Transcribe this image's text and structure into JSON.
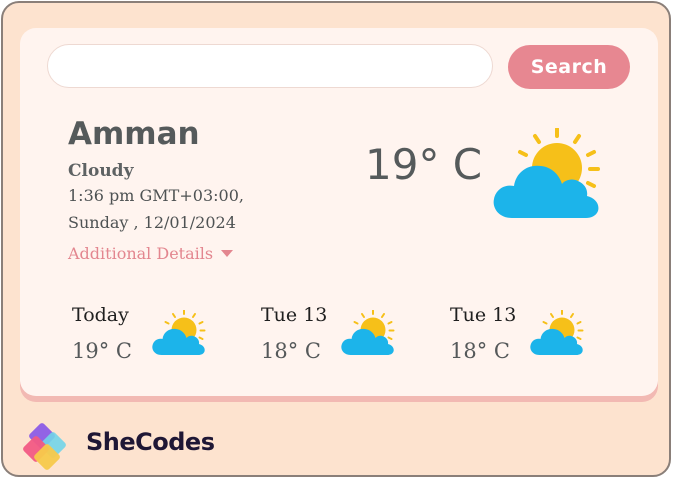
{
  "search": {
    "placeholder": "",
    "value": "",
    "button_label": "Search"
  },
  "current": {
    "city": "Amman",
    "description": "Cloudy",
    "time": "1:36 pm GMT+03:00,",
    "date": "Sunday , 12/01/2024",
    "details_link": "Additional Details",
    "temperature": "19° C",
    "icon": "partly-cloudy-icon"
  },
  "forecast": [
    {
      "label": "Today",
      "temp": "19° C",
      "icon": "partly-cloudy-icon"
    },
    {
      "label": "Tue 13",
      "temp": "18° C",
      "icon": "partly-cloudy-icon"
    },
    {
      "label": "Tue 13",
      "temp": "18° C",
      "icon": "partly-cloudy-icon"
    }
  ],
  "brand": {
    "name": "SheCodes",
    "logo": "shecodes-logo-icon"
  },
  "colors": {
    "page_bg": "#fde3cf",
    "card_bg": "#fff4ef",
    "accent": "#e78791",
    "text": "#555a5b",
    "sun": "#f6c019",
    "cloud": "#1cb4ea"
  }
}
